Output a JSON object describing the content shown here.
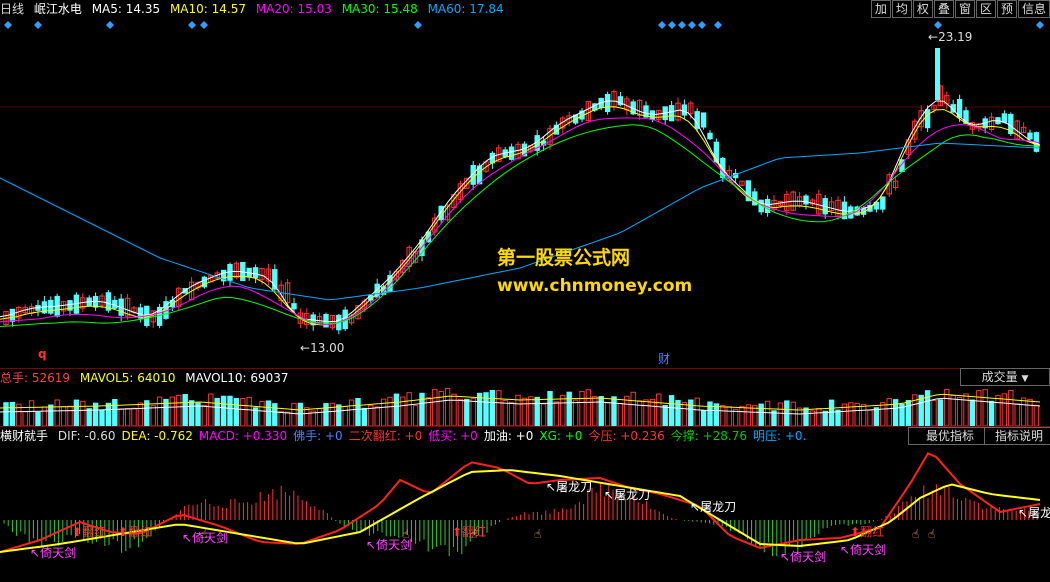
{
  "price_header": {
    "period": "日线",
    "stock": "岷江水电",
    "ma5": "MA5: 14.35",
    "ma10": "MA10: 14.57",
    "ma20": "MA20: 15.03",
    "ma30": "MA30: 15.48",
    "ma60": "MA60: 17.84"
  },
  "toolbar": [
    "加",
    "均",
    "权",
    "叠",
    "窗",
    "区",
    "预",
    "信息"
  ],
  "price_annotations": {
    "high": "23.19",
    "low": "13.00",
    "q_mark": "q",
    "cai_mark": "财"
  },
  "watermark": {
    "line1": "第一股票公式网",
    "line2": "www.chnmoney.com"
  },
  "volume_header": {
    "total": "总手: 52619",
    "mavol5": "MAVOL5: 64010",
    "mavol10": "MAVOL10: 69037",
    "dropdown": "成交量"
  },
  "indicator_header": {
    "name": "横财就手",
    "items": [
      {
        "t": "DIF: -0.60",
        "c": "#dddddd"
      },
      {
        "t": "DEA: -0.762",
        "c": "#ffff00"
      },
      {
        "t": "MACD: +0.330",
        "c": "#ff00ff"
      },
      {
        "t": "佛手: +0",
        "c": "#4f7fff"
      },
      {
        "t": "二次翻红: +0",
        "c": "#ff3030"
      },
      {
        "t": "低买: +0",
        "c": "#ff00ff"
      },
      {
        "t": "加油: +0",
        "c": "#ffffff"
      },
      {
        "t": "XG: +0",
        "c": "#00ff00"
      },
      {
        "t": "今压: +0.236",
        "c": "#ff3030"
      },
      {
        "t": "今撑: +28.76",
        "c": "#00cc00"
      },
      {
        "t": "明压: +0.",
        "c": "#00aaff"
      }
    ],
    "btn_best": "最优指标",
    "btn_help": "指标说明"
  },
  "indicator_labels": [
    {
      "t": "倚天剑",
      "c": "#ff44ff"
    },
    {
      "t": "翻红",
      "c": "#ff3030"
    },
    {
      "t": "翻红",
      "c": "#ff3030"
    },
    {
      "t": "倚天剑",
      "c": "#ff44ff"
    },
    {
      "t": "倚天剑",
      "c": "#ff44ff"
    },
    {
      "t": "翻红",
      "c": "#ff3030"
    },
    {
      "t": "屠龙刀",
      "c": "#ffffff"
    },
    {
      "t": "屠龙刀",
      "c": "#ffffff"
    },
    {
      "t": "屠龙刀",
      "c": "#ffffff"
    },
    {
      "t": "倚天剑",
      "c": "#ff44ff"
    },
    {
      "t": "倚天剑",
      "c": "#ff44ff"
    },
    {
      "t": "翻红",
      "c": "#ff3030"
    },
    {
      "t": "屠龙",
      "c": "#ffffff"
    }
  ],
  "colors": {
    "up": "#ff3232",
    "down": "#54ffff",
    "ma5": "#ffffff",
    "ma10": "#ffff00",
    "ma20": "#ff00ff",
    "ma30": "#00ff00",
    "ma60": "#00aaff"
  }
}
